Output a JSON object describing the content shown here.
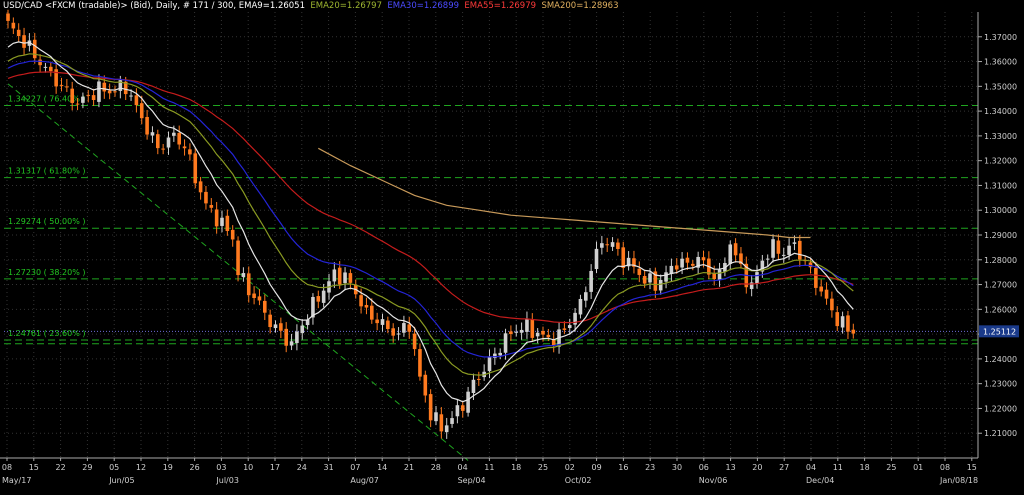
{
  "chart_data": {
    "type": "candlestick",
    "header": {
      "symbol": "USD/CAD <FXCM (tradable)> (Bid), Daily, # 171 / 300,",
      "ema9": "EMA9=1.26051",
      "ema20": "EMA20=1.26797",
      "ema30": "EMA30=1.26899",
      "ema55": "EMA55=1.26979",
      "sma200": "SMA200=1.28963"
    },
    "ylim": [
      1.2,
      1.38
    ],
    "y_ticks": [
      "1.37000",
      "1.36000",
      "1.35000",
      "1.34000",
      "1.33000",
      "1.32000",
      "1.31000",
      "1.30000",
      "1.29000",
      "1.28000",
      "1.27000",
      "1.26000",
      "1.25000",
      "1.24000",
      "1.23000",
      "1.22000",
      "1.21000"
    ],
    "y_tick_values": [
      1.37,
      1.36,
      1.35,
      1.34,
      1.33,
      1.32,
      1.31,
      1.3,
      1.29,
      1.28,
      1.27,
      1.26,
      1.25,
      1.24,
      1.23,
      1.22,
      1.21
    ],
    "current_price": "1.25112",
    "current_price_value": 1.25112,
    "x_day_ticks": [
      "08",
      "15",
      "22",
      "29",
      "05",
      "12",
      "19",
      "26",
      "03",
      "10",
      "17",
      "24",
      "31",
      "07",
      "14",
      "21",
      "28",
      "04",
      "11",
      "18",
      "25",
      "02",
      "09",
      "16",
      "23",
      "30",
      "06",
      "13",
      "20",
      "27",
      "04",
      "11",
      "18",
      "25",
      "01",
      "08",
      "15",
      "22"
    ],
    "x_month_labels": [
      {
        "label": "May/17",
        "tick": 0
      },
      {
        "label": "Jun/05",
        "tick": 4
      },
      {
        "label": "Jul/03",
        "tick": 8
      },
      {
        "label": "Aug/07",
        "tick": 13
      },
      {
        "label": "Sep/04",
        "tick": 17
      },
      {
        "label": "Oct/02",
        "tick": 21
      },
      {
        "label": "Nov/06",
        "tick": 26
      },
      {
        "label": "Dec/04",
        "tick": 30
      },
      {
        "label": "Jan/08/18",
        "tick": 35
      }
    ],
    "fibonacci": [
      {
        "label": "1.34227  ( 76.40% )",
        "value": 1.34227
      },
      {
        "label": "1.31317  ( 61.80% )",
        "value": 1.31317
      },
      {
        "label": "1.29274  ( 50.00% )",
        "value": 1.29274
      },
      {
        "label": "1.27230  ( 38.20% )",
        "value": 1.2723
      },
      {
        "label": "1.24761  ( 23.60% )",
        "value": 1.24761
      }
    ],
    "fib_extra_level": 1.2461,
    "trendline": {
      "from": [
        0,
        1.351
      ],
      "to": [
        86,
        1.199
      ]
    },
    "colors": {
      "up": "#d0d0d0",
      "down": "#ff7a1f",
      "ema9": "#e6e6e6",
      "ema20": "#8a9a22",
      "ema30": "#2424d6",
      "ema55": "#c41c1c",
      "sma200": "#c89a5a",
      "fib": "#1fa51f",
      "trend": "#1fa51f",
      "grid": "#333333",
      "axis": "#aaaaaa",
      "price_box": "#1a3a8a"
    },
    "anchors": [
      [
        0,
        1.375
      ],
      [
        3,
        1.368
      ],
      [
        7,
        1.357
      ],
      [
        10,
        1.35
      ],
      [
        13,
        1.343
      ],
      [
        17,
        1.349
      ],
      [
        19,
        1.348
      ],
      [
        22,
        1.35
      ],
      [
        25,
        1.337
      ],
      [
        26,
        1.333
      ],
      [
        28,
        1.325
      ],
      [
        31,
        1.33
      ],
      [
        33,
        1.326
      ],
      [
        35,
        1.313
      ],
      [
        37,
        1.302
      ],
      [
        39,
        1.297
      ],
      [
        42,
        1.289
      ],
      [
        43,
        1.275
      ],
      [
        45,
        1.268
      ],
      [
        47,
        1.262
      ],
      [
        49,
        1.255
      ],
      [
        51,
        1.25
      ],
      [
        53,
        1.246
      ],
      [
        56,
        1.258
      ],
      [
        58,
        1.265
      ],
      [
        61,
        1.274
      ],
      [
        63,
        1.273
      ],
      [
        65,
        1.267
      ],
      [
        67,
        1.258
      ],
      [
        69,
        1.256
      ],
      [
        71,
        1.252
      ],
      [
        73,
        1.25
      ],
      [
        75,
        1.254
      ],
      [
        77,
        1.232
      ],
      [
        79,
        1.218
      ],
      [
        81,
        1.212
      ],
      [
        83,
        1.216
      ],
      [
        85,
        1.222
      ],
      [
        87,
        1.23
      ],
      [
        89,
        1.236
      ],
      [
        91,
        1.242
      ],
      [
        93,
        1.248
      ],
      [
        95,
        1.252
      ],
      [
        97,
        1.253
      ],
      [
        99,
        1.25
      ],
      [
        101,
        1.248
      ],
      [
        103,
        1.249
      ],
      [
        105,
        1.255
      ],
      [
        107,
        1.262
      ],
      [
        109,
        1.276
      ],
      [
        111,
        1.288
      ],
      [
        113,
        1.286
      ],
      [
        115,
        1.28
      ],
      [
        117,
        1.277
      ],
      [
        119,
        1.272
      ],
      [
        121,
        1.27
      ],
      [
        123,
        1.274
      ],
      [
        125,
        1.279
      ],
      [
        127,
        1.278
      ],
      [
        129,
        1.281
      ],
      [
        131,
        1.275
      ],
      [
        133,
        1.273
      ],
      [
        135,
        1.287
      ],
      [
        137,
        1.276
      ],
      [
        139,
        1.269
      ],
      [
        141,
        1.28
      ],
      [
        143,
        1.285
      ],
      [
        145,
        1.283
      ],
      [
        147,
        1.286
      ],
      [
        149,
        1.279
      ],
      [
        151,
        1.271
      ],
      [
        153,
        1.263
      ],
      [
        155,
        1.256
      ],
      [
        157,
        1.252
      ],
      [
        158,
        1.251
      ]
    ],
    "sma200_points": [
      [
        58,
        1.325
      ],
      [
        64,
        1.318
      ],
      [
        70,
        1.312
      ],
      [
        76,
        1.306
      ],
      [
        82,
        1.302
      ],
      [
        88,
        1.3
      ],
      [
        94,
        1.298
      ],
      [
        100,
        1.297
      ],
      [
        106,
        1.296
      ],
      [
        112,
        1.295
      ],
      [
        118,
        1.294
      ],
      [
        124,
        1.293
      ],
      [
        130,
        1.292
      ],
      [
        136,
        1.291
      ],
      [
        142,
        1.29
      ],
      [
        146,
        1.289
      ],
      [
        150,
        1.289
      ]
    ]
  }
}
